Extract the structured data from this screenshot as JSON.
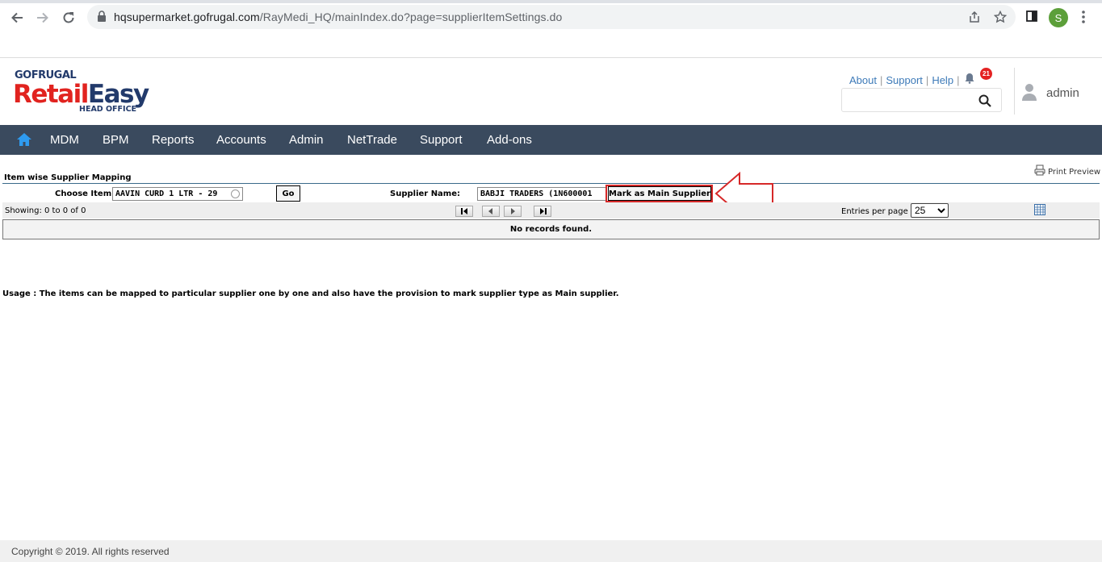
{
  "browser": {
    "url_host": "hqsupermarket.gofrugal.com",
    "url_path": "/RayMedi_HQ/mainIndex.do?page=supplierItemSettings.do",
    "profile_initial": "S"
  },
  "header": {
    "logo_top": "GOFRUGAL",
    "logo_retail": "Retail",
    "logo_easy": "Easy",
    "logo_sub": "HEAD OFFICE",
    "links": [
      "About",
      "Support",
      "Help"
    ],
    "notification_count": "21",
    "user": "admin"
  },
  "nav": {
    "items": [
      "MDM",
      "BPM",
      "Reports",
      "Accounts",
      "Admin",
      "NetTrade",
      "Support",
      "Add-ons"
    ]
  },
  "page": {
    "title": "Item wise Supplier Mapping",
    "print_preview": "Print Preview",
    "choose_item_label": "Choose Item :",
    "choose_item_value": "AAVIN CURD 1 LTR - 29",
    "go_button": "Go",
    "supplier_label": "Supplier Name:",
    "supplier_value": "BABJI TRADERS (1N600001",
    "mark_main_button": "Mark as Main Supplier",
    "showing": "Showing: 0 to 0 of 0",
    "entries_label": "Entries per page",
    "entries_value": "25",
    "entries_options": [
      "25"
    ],
    "no_records": "No records found.",
    "usage": "Usage : The items can be mapped to particular supplier one by one and also have the provision to mark supplier type as Main supplier."
  },
  "footer": {
    "copyright": "Copyright © 2019. All rights reserved"
  },
  "colors": {
    "navbar": "#3a4a5e",
    "brand_red": "#e1231f",
    "brand_navy": "#223a6b",
    "highlight": "#d62828"
  }
}
